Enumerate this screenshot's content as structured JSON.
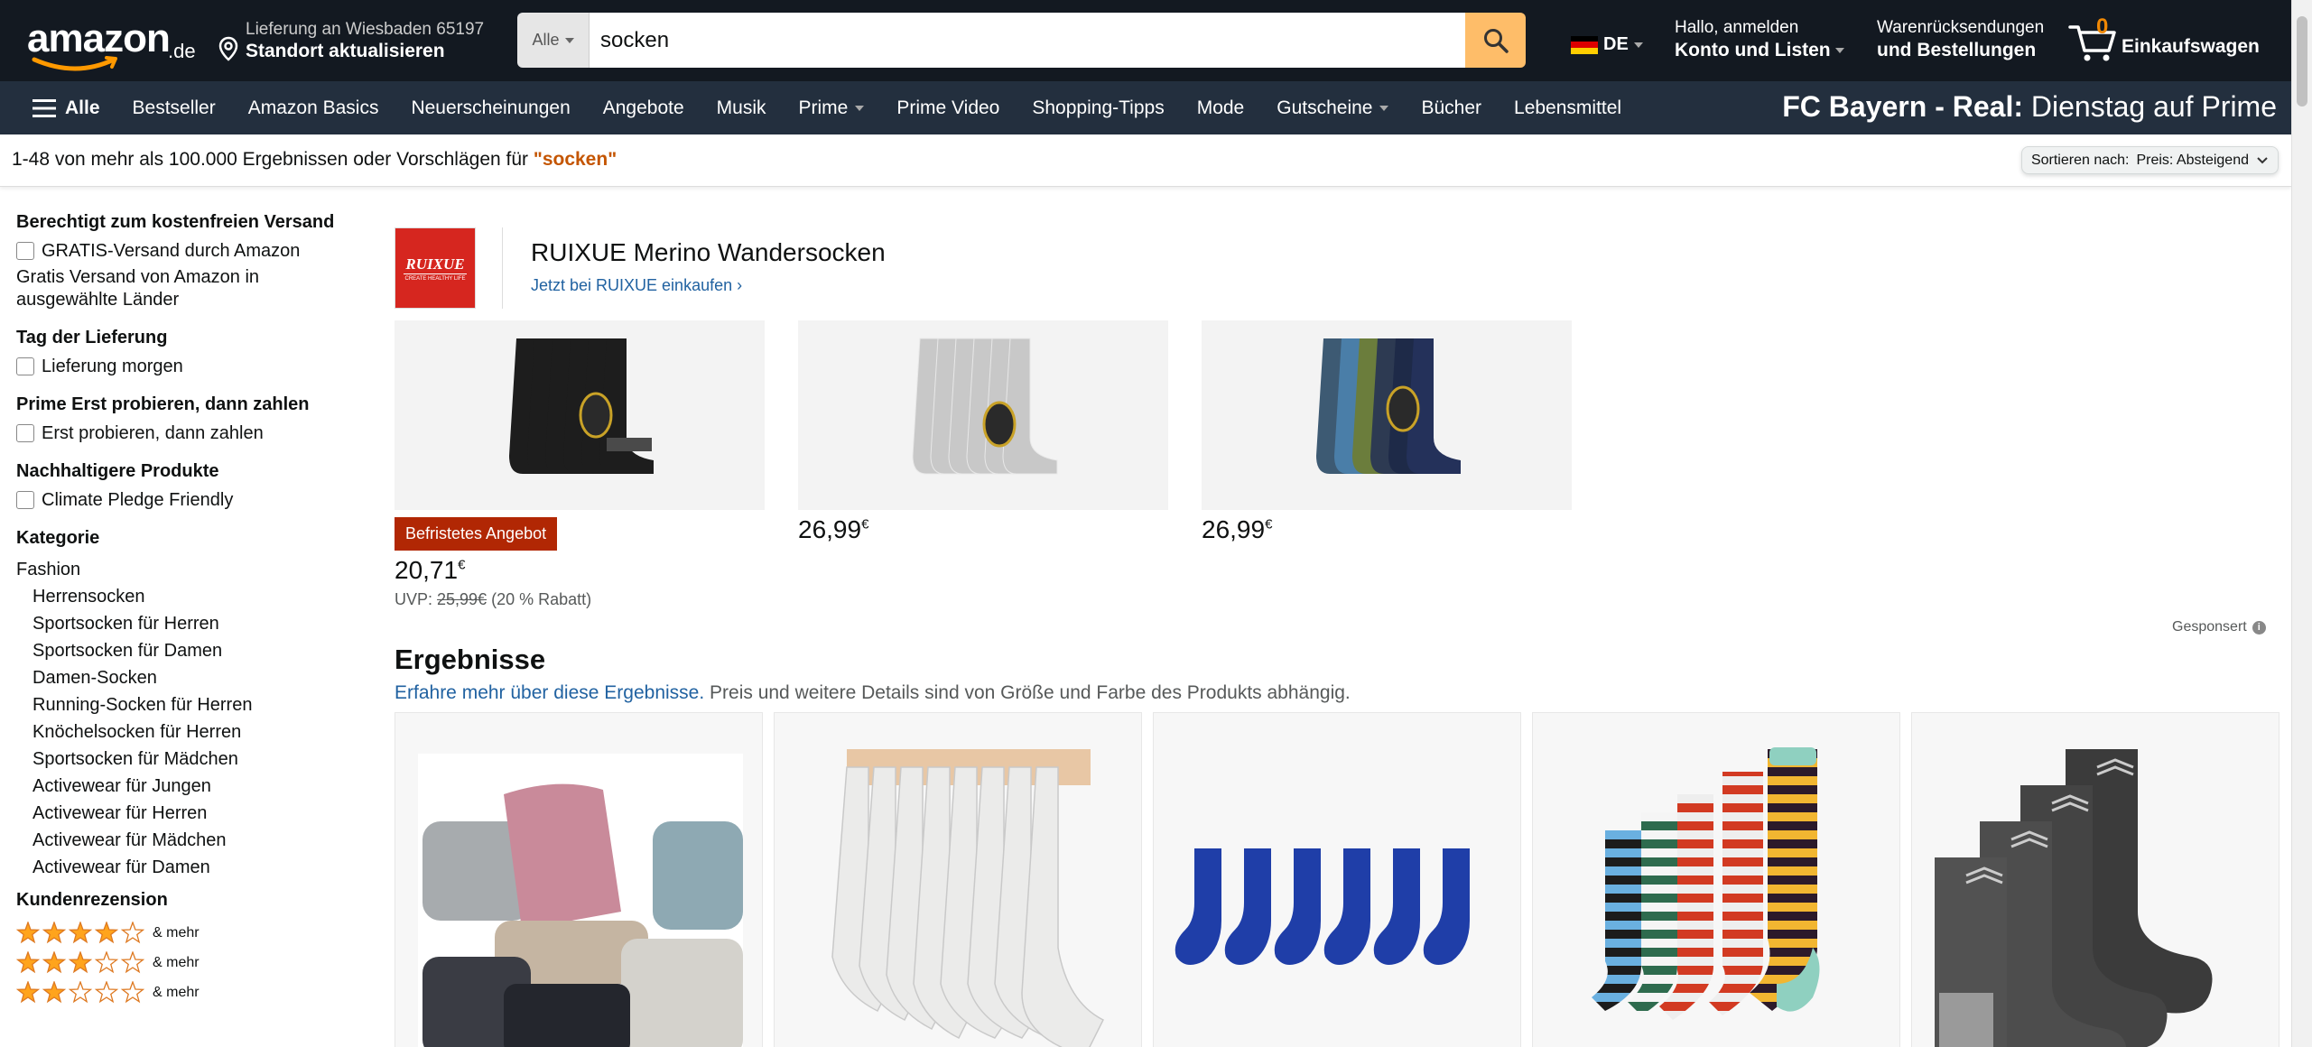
{
  "header": {
    "logo_text": "amazon",
    "logo_tld": ".de",
    "deliver_line1": "Lieferung an Wiesbaden 65197",
    "deliver_line2": "Standort aktualisieren",
    "search_category": "Alle",
    "search_value": "socken",
    "lang": "DE",
    "account_line1": "Hallo, anmelden",
    "account_line2": "Konto und Listen",
    "returns_line1": "Warenrücksendungen",
    "returns_line2": "und Bestellungen",
    "cart_count": "0",
    "cart_label": "Einkaufswagen"
  },
  "nav": {
    "all_label": "Alle",
    "links": [
      "Bestseller",
      "Amazon Basics",
      "Neuerscheinungen",
      "Angebote",
      "Musik",
      "Prime",
      "Prime Video",
      "Shopping-Tipps",
      "Mode",
      "Gutscheine",
      "Bücher",
      "Lebensmittel"
    ],
    "promo_bold": "FC Bayern - Real:",
    "promo_rest": " Dienstag auf Prime"
  },
  "results": {
    "prefix": "1-48 von mehr als 100.000 Ergebnissen oder Vorschlägen für ",
    "query": "\"socken\"",
    "sort_label": "Sortieren nach:",
    "sort_value": "Preis: Absteigend"
  },
  "sidebar": {
    "shipping_heading": "Berechtigt zum kostenfreien Versand",
    "shipping_option": "GRATIS-Versand durch Amazon",
    "shipping_note": "Gratis Versand von Amazon in ausgewählte Länder",
    "delivery_heading": "Tag der Lieferung",
    "delivery_option": "Lieferung morgen",
    "prime_heading": "Prime Erst probieren, dann zahlen",
    "prime_option": "Erst probieren, dann zahlen",
    "sustain_heading": "Nachhaltigere Produkte",
    "sustain_option": "Climate Pledge Friendly",
    "category_heading": "Kategorie",
    "category_root": "Fashion",
    "categories": [
      "Herrensocken",
      "Sportsocken für Herren",
      "Sportsocken für Damen",
      "Damen-Socken",
      "Running-Socken für Herren",
      "Knöchelsocken für Herren",
      "Sportsocken für Mädchen",
      "Activewear für Jungen",
      "Activewear für Herren",
      "Activewear für Mädchen",
      "Activewear für Damen"
    ],
    "review_heading": "Kundenrezension",
    "review_more": "& mehr",
    "review_rows": [
      4,
      3,
      2
    ]
  },
  "sponsored_brand": {
    "logo_name": "RUIXUE",
    "logo_tagline": "CREATE HEALTHY LIFE",
    "title": "RUIXUE Merino Wandersocken",
    "link": "Jetzt bei RUIXUE einkaufen ›",
    "items": [
      {
        "badge": "Befristetes Angebot",
        "price_main": "20,71",
        "price_cur": "€",
        "uvp_label": "UVP: ",
        "uvp_old": "25,99€",
        "uvp_disc": " (20 % Rabatt)"
      },
      {
        "price_main": "26,99",
        "price_cur": "€"
      },
      {
        "price_main": "26,99",
        "price_cur": "€"
      }
    ],
    "sponsored_label": "Gesponsert"
  },
  "main": {
    "results_heading": "Ergebnisse",
    "results_link": "Erfahre mehr über diese Ergebnisse.",
    "results_note": " Preis und weitere Details sind von Größe und Farbe des Produkts abhängig."
  },
  "colors": {
    "header_bg": "#131921",
    "nav_bg": "#232f3e",
    "search_btn": "#febd69",
    "query_color": "#c45500",
    "link_color": "#2162a1",
    "badge_red": "#b12704"
  }
}
